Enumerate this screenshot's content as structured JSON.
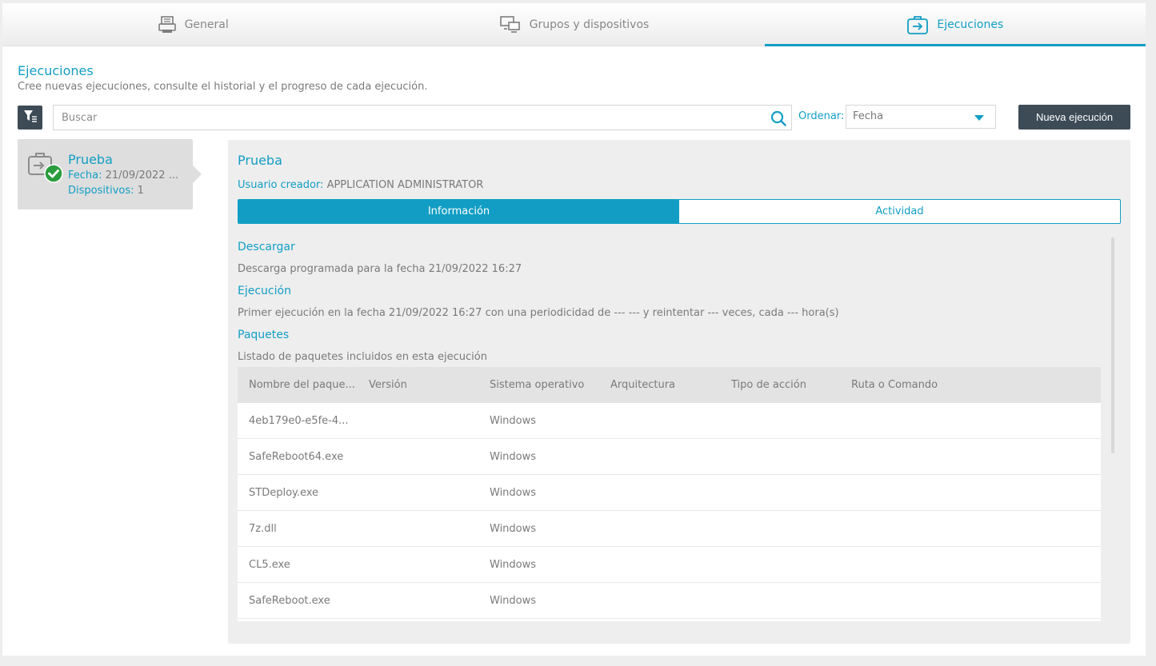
{
  "tabs": [
    {
      "label": "General",
      "icon": "printer-icon",
      "active": false
    },
    {
      "label": "Grupos y dispositivos",
      "icon": "devices-icon",
      "active": false
    },
    {
      "label": "Ejecuciones",
      "icon": "briefcase-arrow-icon",
      "active": true
    }
  ],
  "header": {
    "title": "Ejecuciones",
    "subtitle": "Cree nuevas ejecuciones, consulte el historial y el progreso de cada ejecución."
  },
  "toolbar": {
    "search_placeholder": "Buscar",
    "sort_label": "Ordenar:",
    "sort_value": "Fecha",
    "new_button": "Nueva ejecución"
  },
  "executions": [
    {
      "name": "Prueba",
      "date_label": "Fecha:",
      "date_value": "21/09/2022 ...",
      "devices_label": "Dispositivos:",
      "devices_value": "1",
      "status": "success"
    }
  ],
  "detail": {
    "title": "Prueba",
    "creator_label": "Usuario creador:",
    "creator_value": "APPLICATION ADMINISTRATOR",
    "segments": [
      "Información",
      "Actividad"
    ],
    "active_segment": "Información",
    "download_heading": "Descargar",
    "download_text": "Descarga programada para la fecha 21/09/2022 16:27",
    "execution_heading": "Ejecución",
    "execution_text": "Primer ejecución en la fecha 21/09/2022 16:27 con una periodicidad de --- --- y reintentar --- veces, cada --- hora(s)",
    "packages_heading": "Paquetes",
    "packages_text": "Listado de paquetes incluidos en esta ejecución",
    "table": {
      "columns": [
        "Nombre del paque...",
        "Versión",
        "Sistema operativo",
        "Arquitectura",
        "Tipo de acción",
        "Ruta o Comando"
      ],
      "rows": [
        [
          "4eb179e0-e5fe-4...",
          "",
          "Windows",
          "",
          "",
          ""
        ],
        [
          "SafeReboot64.exe",
          "",
          "Windows",
          "",
          "",
          ""
        ],
        [
          "STDeploy.exe",
          "",
          "Windows",
          "",
          "",
          ""
        ],
        [
          "7z.dll",
          "",
          "Windows",
          "",
          "",
          ""
        ],
        [
          "CL5.exe",
          "",
          "Windows",
          "",
          "",
          ""
        ],
        [
          "SafeReboot.exe",
          "",
          "Windows",
          "",
          "",
          ""
        ]
      ]
    }
  },
  "colors": {
    "accent": "#129ec4",
    "dark_button": "#3d4b57",
    "success": "#2a9d3c"
  }
}
